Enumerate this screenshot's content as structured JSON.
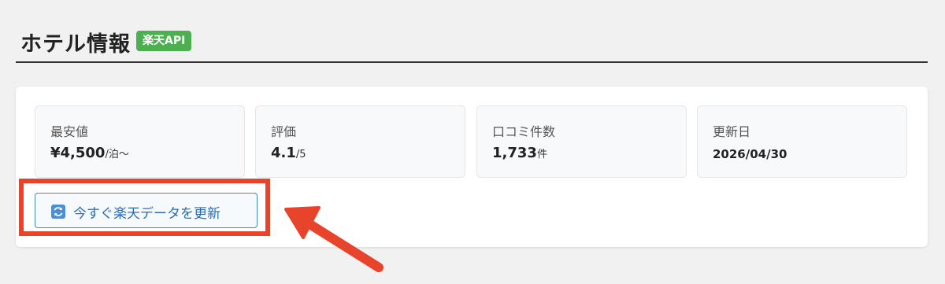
{
  "header": {
    "title": "ホテル情報",
    "badge": "楽天API"
  },
  "stats": [
    {
      "label": "最安値",
      "value": "¥4,500",
      "unit": "/泊〜"
    },
    {
      "label": "評価",
      "value": "4.1",
      "unit": "/5"
    },
    {
      "label": "口コミ件数",
      "value": "1,733",
      "unit": "件"
    },
    {
      "label": "更新日",
      "value": "2026/04/30",
      "unit": ""
    }
  ],
  "refresh_button": {
    "label": "今すぐ楽天データを更新",
    "icon": "refresh-icon"
  },
  "colors": {
    "badge_bg": "#4caf50",
    "button_border": "#3d8ad4",
    "button_text": "#2b6cb0",
    "annotation_red": "#e8432b"
  }
}
